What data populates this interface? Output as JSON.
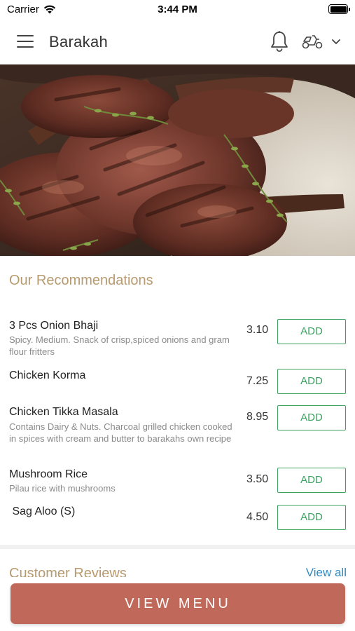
{
  "status_bar": {
    "carrier": "Carrier",
    "time": "3:44 PM",
    "wifi_icon": "wifi-icon",
    "battery_icon": "battery-icon"
  },
  "header": {
    "title": "Barakah",
    "menu_icon": "hamburger-menu-icon",
    "notification_icon": "bell-icon",
    "order_mode_icon": "scooter-delivery-icon",
    "dropdown_icon": "chevron-down-icon"
  },
  "hero": {
    "image": "grilled lamb chops with thyme"
  },
  "recommendations": {
    "title": "Our Recommendations",
    "add_label": "ADD",
    "items": [
      {
        "name": "3 Pcs Onion Bhaji",
        "description": "Spicy. Medium. Snack of crisp,spiced onions and gram flour fritters",
        "price": "3.10"
      },
      {
        "name": "Chicken Korma",
        "description": "",
        "price": "7.25"
      },
      {
        "name": "Chicken Tikka Masala",
        "description": "Contains Dairy & Nuts. Charcoal grilled chicken cooked in spices with cream  and butter to barakahs own recipe",
        "price": "8.95"
      },
      {
        "name": "Mushroom Rice",
        "description": "Pilau rice with mushrooms",
        "price": "3.50"
      },
      {
        "name": " Sag Aloo (S)",
        "description": "",
        "price": "4.50"
      }
    ]
  },
  "reviews": {
    "title": "Customer Reviews",
    "view_all": "View all"
  },
  "footer": {
    "view_menu": "VIEW MENU"
  },
  "colors": {
    "accent_title": "#b89a6f",
    "add_button": "#3aa360",
    "view_menu_button": "#c0695b",
    "link": "#2f8dc4"
  }
}
